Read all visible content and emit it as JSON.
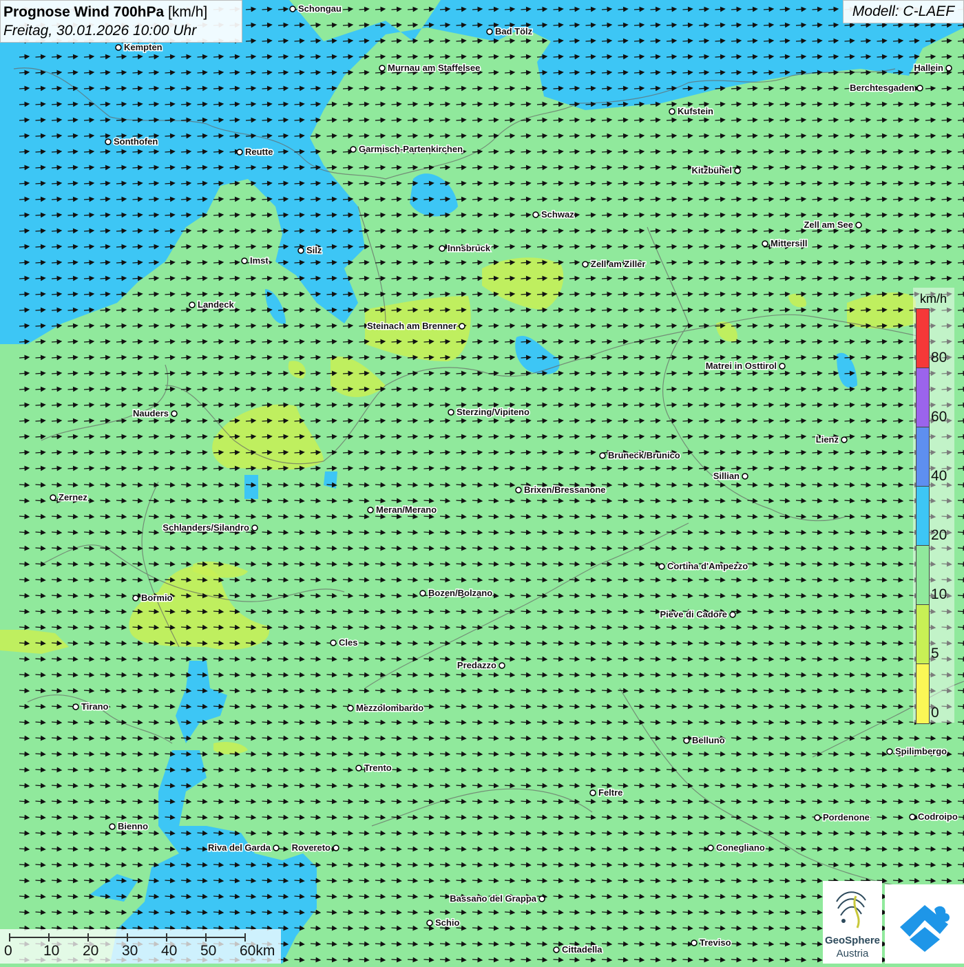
{
  "header": {
    "title_bold": "Prognose Wind 700hPa",
    "title_unit": "[km/h]",
    "datetime": "Freitag, 30.01.2026 10:00 Uhr",
    "model": "Modell: C-LAEF"
  },
  "legend": {
    "unit": "km/h",
    "ticks": [
      "80",
      "60",
      "40",
      "20",
      "10",
      "5",
      "0"
    ],
    "colors": [
      "#f53838",
      "#e9e4f7",
      "#9b64ec",
      "#e7eef9",
      "#5e8ff0",
      "#3dc6f5",
      "#90e99c",
      "#c8f055",
      "#fbf756"
    ]
  },
  "scalebar": {
    "labels": [
      "0",
      "10",
      "20",
      "30",
      "40",
      "50",
      "60km"
    ]
  },
  "logo": {
    "name_line1": "GeoSphere",
    "name_line2": "Austria"
  },
  "wind_arrow_icon": "arrow-right-icon",
  "cities": [
    {
      "name": "Schongau"
    },
    {
      "name": "Bad Tölz"
    },
    {
      "name": "Kempten"
    },
    {
      "name": "Murnau am Staffelsee"
    },
    {
      "name": "Hallein"
    },
    {
      "name": "Berchtesgaden"
    },
    {
      "name": "Kufstein"
    },
    {
      "name": "Sonthofen"
    },
    {
      "name": "Reutte"
    },
    {
      "name": "Garmisch-Partenkirchen"
    },
    {
      "name": "Kitzbühel"
    },
    {
      "name": "Schwaz"
    },
    {
      "name": "Zell am See"
    },
    {
      "name": "Mittersill"
    },
    {
      "name": "Silz"
    },
    {
      "name": "Innsbruck"
    },
    {
      "name": "Imst"
    },
    {
      "name": "Zell am Ziller"
    },
    {
      "name": "Landeck"
    },
    {
      "name": "Steinach am Brenner"
    },
    {
      "name": "Matrei in Osttirol"
    },
    {
      "name": "Nauders"
    },
    {
      "name": "Sterzing/Vipiteno"
    },
    {
      "name": "Lienz"
    },
    {
      "name": "Bruneck/Brunico"
    },
    {
      "name": "Sillian"
    },
    {
      "name": "Brixen/Bressanone"
    },
    {
      "name": "Zernez"
    },
    {
      "name": "Meran/Merano"
    },
    {
      "name": "Schlanders/Silandro"
    },
    {
      "name": "Cortina d'Ampezzo"
    },
    {
      "name": "Bozen/Bolzano"
    },
    {
      "name": "Bormio"
    },
    {
      "name": "Pieve di Cadore"
    },
    {
      "name": "Cles"
    },
    {
      "name": "Predazzo"
    },
    {
      "name": "Tirano"
    },
    {
      "name": "Mezzolombardo"
    },
    {
      "name": "Belluno"
    },
    {
      "name": "Spilimbergo"
    },
    {
      "name": "Trento"
    },
    {
      "name": "Feltre"
    },
    {
      "name": "Pordenone"
    },
    {
      "name": "Codroipo"
    },
    {
      "name": "Bienno"
    },
    {
      "name": "Riva del Garda"
    },
    {
      "name": "Rovereto"
    },
    {
      "name": "Conegliano"
    },
    {
      "name": "Bassano del Grappa"
    },
    {
      "name": "Schio"
    },
    {
      "name": "Treviso"
    },
    {
      "name": "Cittadella"
    }
  ]
}
